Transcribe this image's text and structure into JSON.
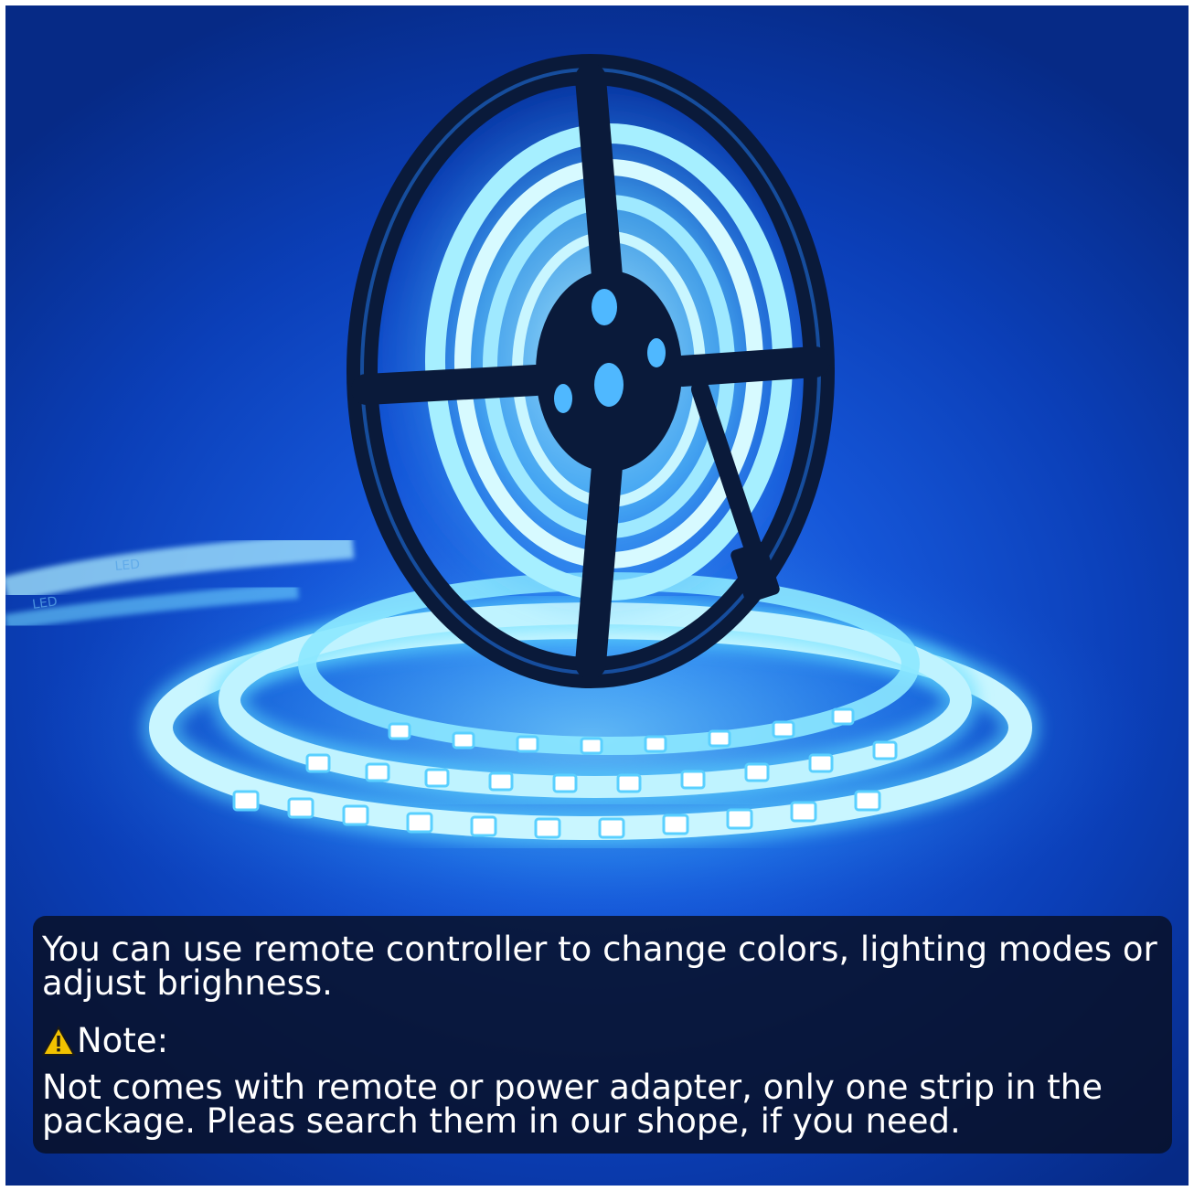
{
  "caption": {
    "main_text": "You can use remote controller to change colors, lighting modes or adjust brighness.",
    "note_icon": "warning-triangle-icon",
    "note_label": "Note:",
    "note_text": "Not comes with remote or power adapter, only one strip in the package. Pleas search them in our shope, if you need."
  },
  "strip_printed_text": "LED",
  "colors": {
    "background": "#0b3fb8",
    "led_glow": "#7fe6ff",
    "reel": "#0a1a3a",
    "caption_box": "#081028",
    "warning_fill": "#f2c200"
  }
}
